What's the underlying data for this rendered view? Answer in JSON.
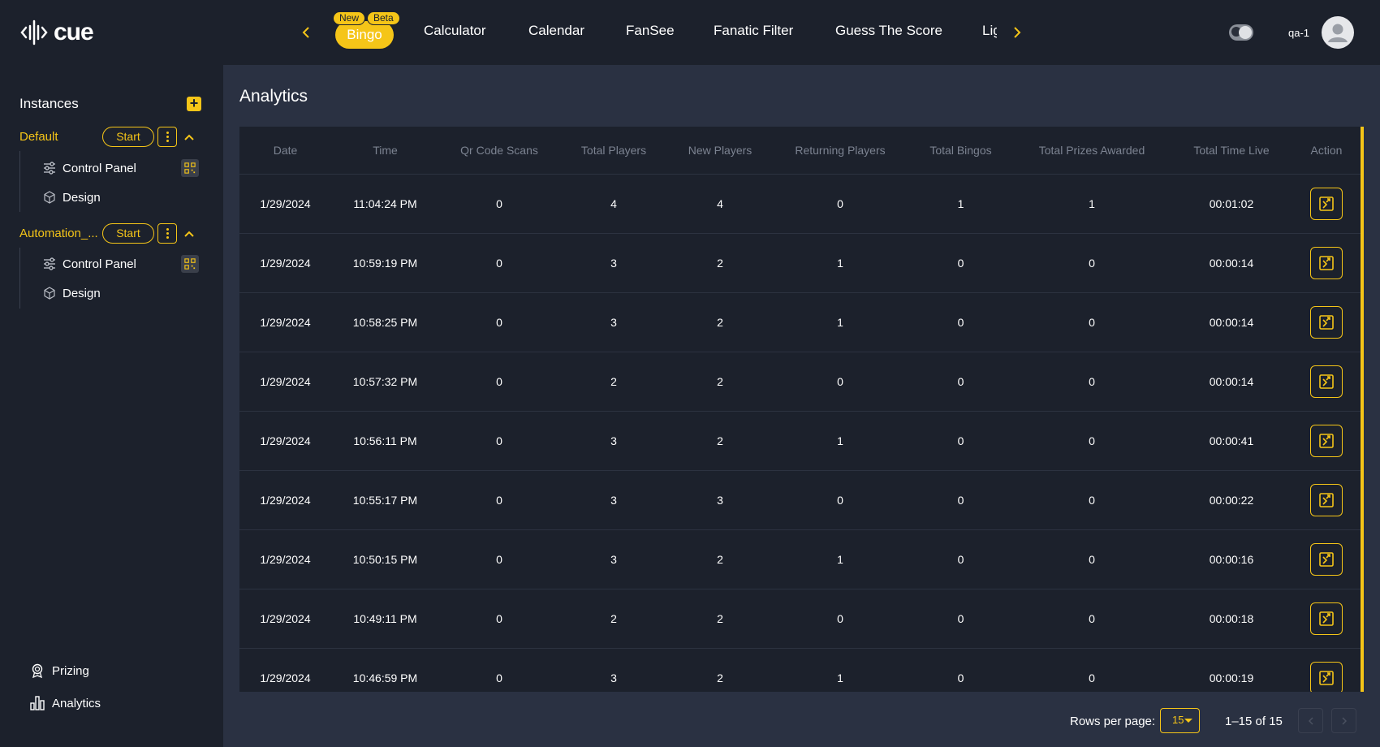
{
  "app": {
    "logo_text": "cue"
  },
  "nav": {
    "tabs": [
      {
        "label": "Bingo",
        "active": true,
        "tags": [
          "New",
          "Beta"
        ]
      },
      {
        "label": "Calculator"
      },
      {
        "label": "Calendar"
      },
      {
        "label": "FanSee"
      },
      {
        "label": "Fanatic Filter"
      },
      {
        "label": "Guess The Score"
      },
      {
        "label": "Lig"
      }
    ]
  },
  "user": {
    "name": "qa-1"
  },
  "sidebar": {
    "title": "Instances",
    "instances": [
      {
        "name": "Default",
        "start_label": "Start",
        "items": [
          {
            "label": "Control Panel",
            "icon": "sliders-icon"
          },
          {
            "label": "Design",
            "icon": "cube-icon"
          }
        ]
      },
      {
        "name": "Automation_...",
        "start_label": "Start",
        "items": [
          {
            "label": "Control Panel",
            "icon": "sliders-icon"
          },
          {
            "label": "Design",
            "icon": "cube-icon"
          }
        ]
      }
    ],
    "bottom": [
      {
        "label": "Prizing",
        "icon": "award-icon"
      },
      {
        "label": "Analytics",
        "icon": "bar-chart-icon"
      }
    ]
  },
  "main": {
    "title": "Analytics",
    "table": {
      "columns": [
        "Date",
        "Time",
        "Qr Code Scans",
        "Total Players",
        "New Players",
        "Returning Players",
        "Total Bingos",
        "Total Prizes Awarded",
        "Total Time Live",
        "Action"
      ],
      "rows": [
        [
          "1/29/2024",
          "11:04:24 PM",
          "0",
          "4",
          "4",
          "0",
          "1",
          "1",
          "00:01:02"
        ],
        [
          "1/29/2024",
          "10:59:19 PM",
          "0",
          "3",
          "2",
          "1",
          "0",
          "0",
          "00:00:14"
        ],
        [
          "1/29/2024",
          "10:58:25 PM",
          "0",
          "3",
          "2",
          "1",
          "0",
          "0",
          "00:00:14"
        ],
        [
          "1/29/2024",
          "10:57:32 PM",
          "0",
          "2",
          "2",
          "0",
          "0",
          "0",
          "00:00:14"
        ],
        [
          "1/29/2024",
          "10:56:11 PM",
          "0",
          "3",
          "2",
          "1",
          "0",
          "0",
          "00:00:41"
        ],
        [
          "1/29/2024",
          "10:55:17 PM",
          "0",
          "3",
          "3",
          "0",
          "0",
          "0",
          "00:00:22"
        ],
        [
          "1/29/2024",
          "10:50:15 PM",
          "0",
          "3",
          "2",
          "1",
          "0",
          "0",
          "00:00:16"
        ],
        [
          "1/29/2024",
          "10:49:11 PM",
          "0",
          "2",
          "2",
          "0",
          "0",
          "0",
          "00:00:18"
        ],
        [
          "1/29/2024",
          "10:46:59 PM",
          "0",
          "3",
          "2",
          "1",
          "0",
          "0",
          "00:00:19"
        ]
      ]
    },
    "footer": {
      "rows_label": "Rows per page:",
      "rows_value": "15",
      "range": "1–15 of 15"
    }
  },
  "colors": {
    "accent": "#f5c518",
    "background": "#1c212c",
    "panel": "#2a3142"
  }
}
